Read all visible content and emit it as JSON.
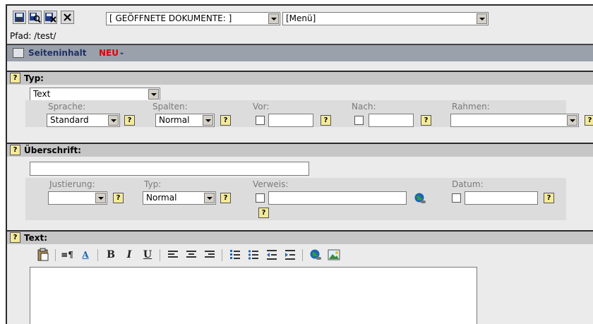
{
  "toolbar": {
    "open_docs_select": "[ GEÖFFNETE DOKUMENTE: ]",
    "menu_select": "[Menü]",
    "close_label": "×"
  },
  "path": "Pfad: /test/",
  "header": {
    "title": "Seiteninhalt",
    "badge": "NEU",
    "suffix": "-"
  },
  "typ_section": {
    "title": "Typ:",
    "type_value": "Text",
    "sprache_label": "Sprache:",
    "sprache_value": "Standard",
    "spalten_label": "Spalten:",
    "spalten_value": "Normal",
    "vor_label": "Vor:",
    "nach_label": "Nach:",
    "rahmen_label": "Rahmen:",
    "rahmen_value": ""
  },
  "ueberschrift_section": {
    "title": "Überschrift:",
    "headline_value": "",
    "justierung_label": "Justierung:",
    "justierung_value": "",
    "typ_label": "Typ:",
    "typ_value": "Normal",
    "verweis_label": "Verweis:",
    "datum_label": "Datum:"
  },
  "text_section": {
    "title": "Text:",
    "bold": "B",
    "italic": "I",
    "underline": "U",
    "font_color": "A"
  },
  "help_glyph": "?",
  "colors": {
    "badge": "#e00000",
    "header_bar": "#9aa1ab",
    "section_bar": "#c6c6c6"
  }
}
